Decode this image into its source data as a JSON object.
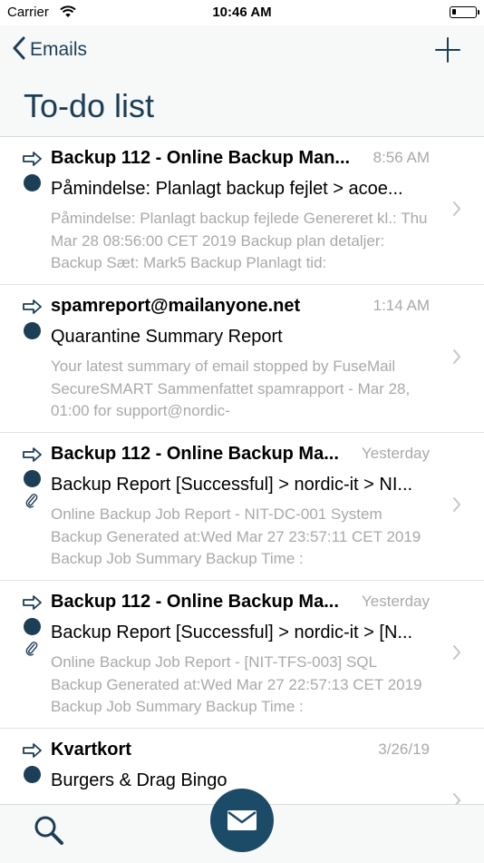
{
  "status_bar": {
    "carrier": "Carrier",
    "time": "10:46 AM"
  },
  "header": {
    "back_label": "Emails",
    "title": "To-do list"
  },
  "colors": {
    "accent": "#1c3e57",
    "compose": "#1c4b67",
    "muted_text": "#a7a9ab"
  },
  "emails": [
    {
      "sender": "Backup 112 - Online Backup Man...",
      "date": "8:56 AM",
      "subject": "Påmindelse: Planlagt backup fejlet > acoe...",
      "preview": "   Påmindelse: Planlagt backup fejlede     Genereret kl.: Thu Mar 28 08:56:00 CET 2019  Backup plan detaljer:  Backup Sæt:  Mark5 Backup   Planlagt tid:",
      "attachment": false
    },
    {
      "sender": "spamreport@mailanyone.net",
      "date": "1:14 AM",
      "subject": "Quarantine Summary Report",
      "preview": "     Your latest summary of email stopped by FuseMail SecureSMART   Sammenfattet spamrapport - Mar 28, 01:00 for support@nordic-",
      "attachment": false
    },
    {
      "sender": "Backup 112 - Online Backup Ma...",
      "date": "Yesterday",
      "subject": "Backup Report [Successful] > nordic-it > NI...",
      "preview": "  Online Backup Job Report  - NIT-DC-001 System Backup     Generated at:Wed Mar 27 23:57:11 CET 2019  Backup Job Summary   Backup Time  :",
      "attachment": true
    },
    {
      "sender": "Backup 112 - Online Backup Ma...",
      "date": "Yesterday",
      "subject": "Backup Report [Successful] > nordic-it > [N...",
      "preview": "  Online Backup Job Report  - [NIT-TFS-003] SQL Backup     Generated at:Wed Mar 27 22:57:13 CET 2019  Backup Job Summary   Backup Time  :",
      "attachment": true
    },
    {
      "sender": "Kvartkort",
      "date": "3/26/19",
      "subject": "Burgers & Drag Bingo",
      "preview": "",
      "attachment": false
    }
  ]
}
